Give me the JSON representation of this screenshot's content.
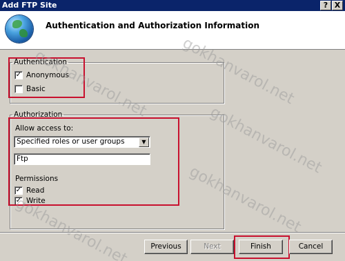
{
  "window": {
    "title": "Add FTP Site",
    "help_button": "?",
    "close_button": "X"
  },
  "header": {
    "title": "Authentication and Authorization Information"
  },
  "authentication": {
    "legend": "Authentication",
    "anonymous": {
      "label": "Anonymous",
      "checked": true
    },
    "basic": {
      "label": "Basic",
      "checked": false
    }
  },
  "authorization": {
    "legend": "Authorization",
    "allow_access_label": "Allow access to:",
    "allow_access_value": "Specified roles or user groups",
    "roles_value": "Ftp",
    "permissions_label": "Permissions",
    "read": {
      "label": "Read",
      "checked": true
    },
    "write": {
      "label": "Write",
      "checked": true
    }
  },
  "buttons": {
    "previous": "Previous",
    "next": "Next",
    "finish": "Finish",
    "cancel": "Cancel"
  },
  "watermark": {
    "text": "gokhanvarol.net"
  },
  "colors": {
    "highlight": "#c8102e",
    "titlebar": "#0a246a",
    "dialog": "#d4d0c8"
  }
}
